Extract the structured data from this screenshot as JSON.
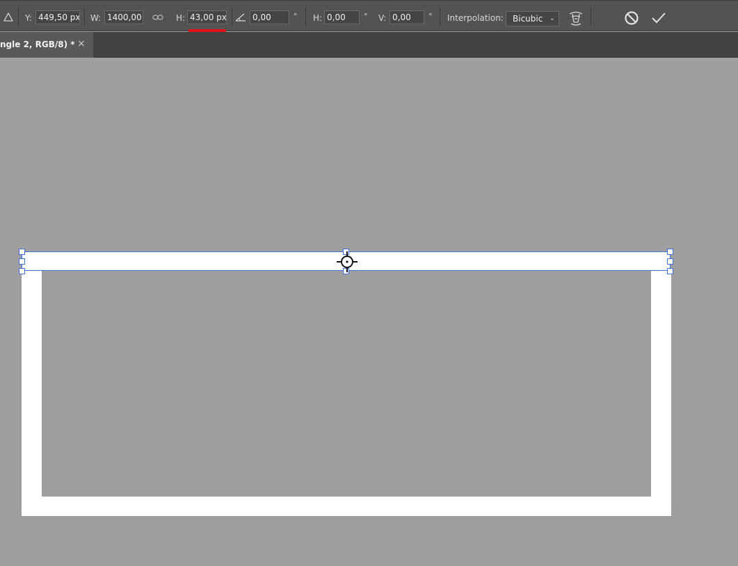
{
  "options_bar": {
    "y_label": "Y:",
    "y_value": "449,50 px",
    "w_label": "W:",
    "w_value": "1400,00",
    "h_label": "H:",
    "h_value": "43,00 px",
    "angle_value": "0,00",
    "degree_symbol": "°",
    "skew_h_label": "H:",
    "skew_h_value": "0,00",
    "skew_v_label": "V:",
    "skew_v_value": "0,00",
    "interpolation_label": "Interpolation:",
    "interpolation_value": "Bicubic"
  },
  "tab": {
    "title": "ngle 2, RGB/8) *",
    "close": "×"
  },
  "colors": {
    "toolbar_bg": "#535353",
    "tabbar_bg": "#424242",
    "canvas_bg": "#9f9f9f",
    "selection_accent": "#3d6fe0",
    "highlight_red": "#e3121a"
  }
}
